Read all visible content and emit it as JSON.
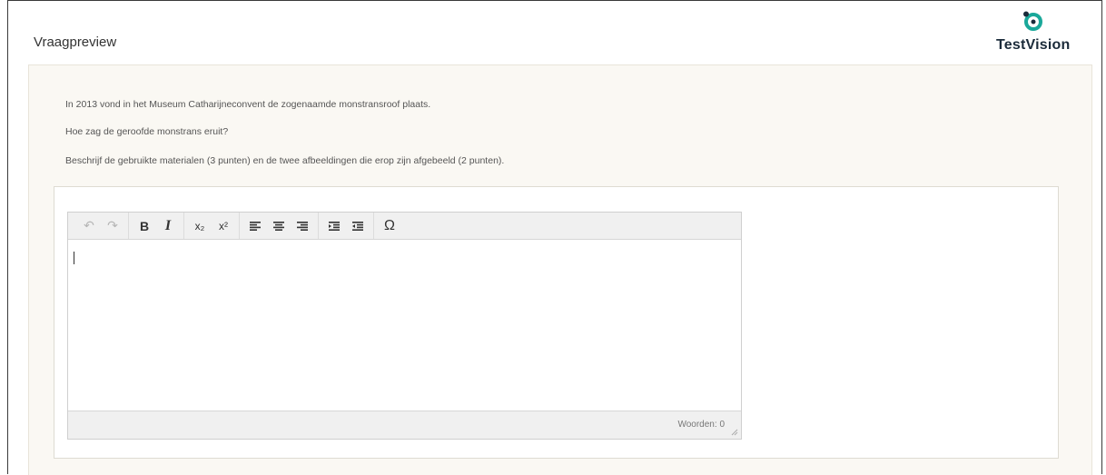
{
  "header": {
    "title": "Vraagpreview",
    "logo_text": "TestVision",
    "logo_color": "#1aa89a"
  },
  "question": {
    "line1": "In 2013 vond in het Museum Catharijneconvent de zogenaamde monstransroof plaats.",
    "line2": "Hoe zag de geroofde monstrans eruit?",
    "line3": "Beschrijf de gebruikte materialen (3 punten) en de twee afbeeldingen die erop zijn afgebeeld (2 punten)."
  },
  "editor": {
    "toolbar": [
      {
        "name": "undo-icon",
        "glyph": "↶",
        "disabled": true
      },
      {
        "name": "redo-icon",
        "glyph": "↷",
        "disabled": true
      },
      {
        "name": "bold-icon",
        "glyph": "B"
      },
      {
        "name": "italic-icon",
        "glyph": "I"
      },
      {
        "name": "subscript-icon",
        "glyph": "x₂"
      },
      {
        "name": "superscript-icon",
        "glyph": "x²"
      },
      {
        "name": "align-left-icon",
        "glyph": "≡"
      },
      {
        "name": "align-center-icon",
        "glyph": "≡"
      },
      {
        "name": "align-right-icon",
        "glyph": "≡"
      },
      {
        "name": "indent-icon",
        "glyph": "⇥"
      },
      {
        "name": "outdent-icon",
        "glyph": "⇤"
      },
      {
        "name": "special-char-icon",
        "glyph": "Ω"
      }
    ],
    "content": "",
    "wordcount_label": "Woorden:",
    "wordcount_value": "0"
  }
}
